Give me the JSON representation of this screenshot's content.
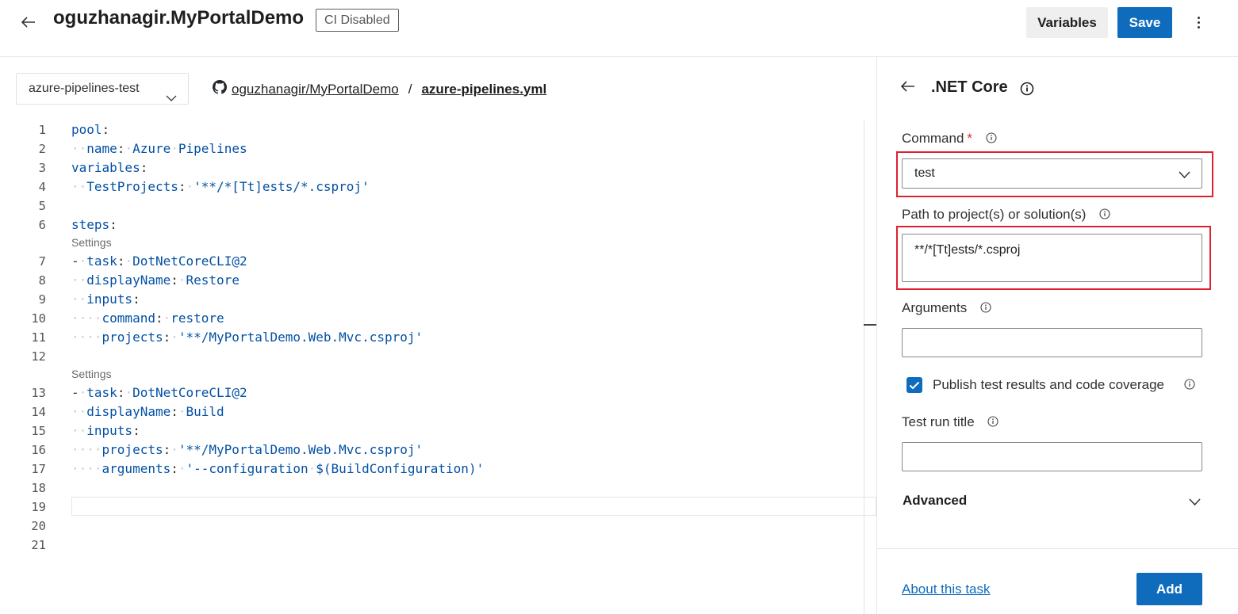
{
  "header": {
    "title": "oguzhanagir.MyPortalDemo",
    "ci_badge": "CI Disabled",
    "variables_label": "Variables",
    "save_label": "Save"
  },
  "toolbar": {
    "branch": "azure-pipelines-test",
    "repo": "oguzhanagir/MyPortalDemo",
    "separator": "/",
    "file": "azure-pipelines.yml"
  },
  "editor": {
    "settings_label": "Settings",
    "lines": [
      {
        "n": "1",
        "text": "pool:"
      },
      {
        "n": "2",
        "text": "  name: Azure Pipelines"
      },
      {
        "n": "3",
        "text": "variables:"
      },
      {
        "n": "4",
        "text": "  TestProjects: '**/*[Tt]ests/*.csproj'"
      },
      {
        "n": "5",
        "text": ""
      },
      {
        "n": "6",
        "text": "steps:"
      },
      {
        "n": "7",
        "text": "- task: DotNetCoreCLI@2"
      },
      {
        "n": "8",
        "text": "  displayName: Restore"
      },
      {
        "n": "9",
        "text": "  inputs:"
      },
      {
        "n": "10",
        "text": "    command: restore"
      },
      {
        "n": "11",
        "text": "    projects: '**/MyPortalDemo.Web.Mvc.csproj'"
      },
      {
        "n": "12",
        "text": ""
      },
      {
        "n": "13",
        "text": "- task: DotNetCoreCLI@2"
      },
      {
        "n": "14",
        "text": "  displayName: Build"
      },
      {
        "n": "15",
        "text": "  inputs:"
      },
      {
        "n": "16",
        "text": "    projects: '**/MyPortalDemo.Web.Mvc.csproj'"
      },
      {
        "n": "17",
        "text": "    arguments: '--configuration $(BuildConfiguration)'"
      },
      {
        "n": "18",
        "text": ""
      },
      {
        "n": "19",
        "text": ""
      },
      {
        "n": "20",
        "text": ""
      },
      {
        "n": "21",
        "text": ""
      }
    ]
  },
  "panel": {
    "title": ".NET Core",
    "command_label": "Command",
    "required_mark": "*",
    "command_value": "test",
    "path_label": "Path to project(s) or solution(s)",
    "path_value": "**/*[Tt]ests/*.csproj",
    "arguments_label": "Arguments",
    "arguments_value": "",
    "publish_label": "Publish test results and code coverage",
    "publish_checked": true,
    "test_run_label": "Test run title",
    "test_run_value": "",
    "advanced_label": "Advanced",
    "about_label": "About this task",
    "add_label": "Add"
  },
  "colors": {
    "accent": "#0f6cbd",
    "highlight_box": "#e0202e",
    "yaml_token": "#0451a5"
  },
  "icons": [
    "back-arrow-icon",
    "more-vertical-icon",
    "chevron-down-icon",
    "github-icon",
    "info-icon",
    "checkmark-icon"
  ]
}
